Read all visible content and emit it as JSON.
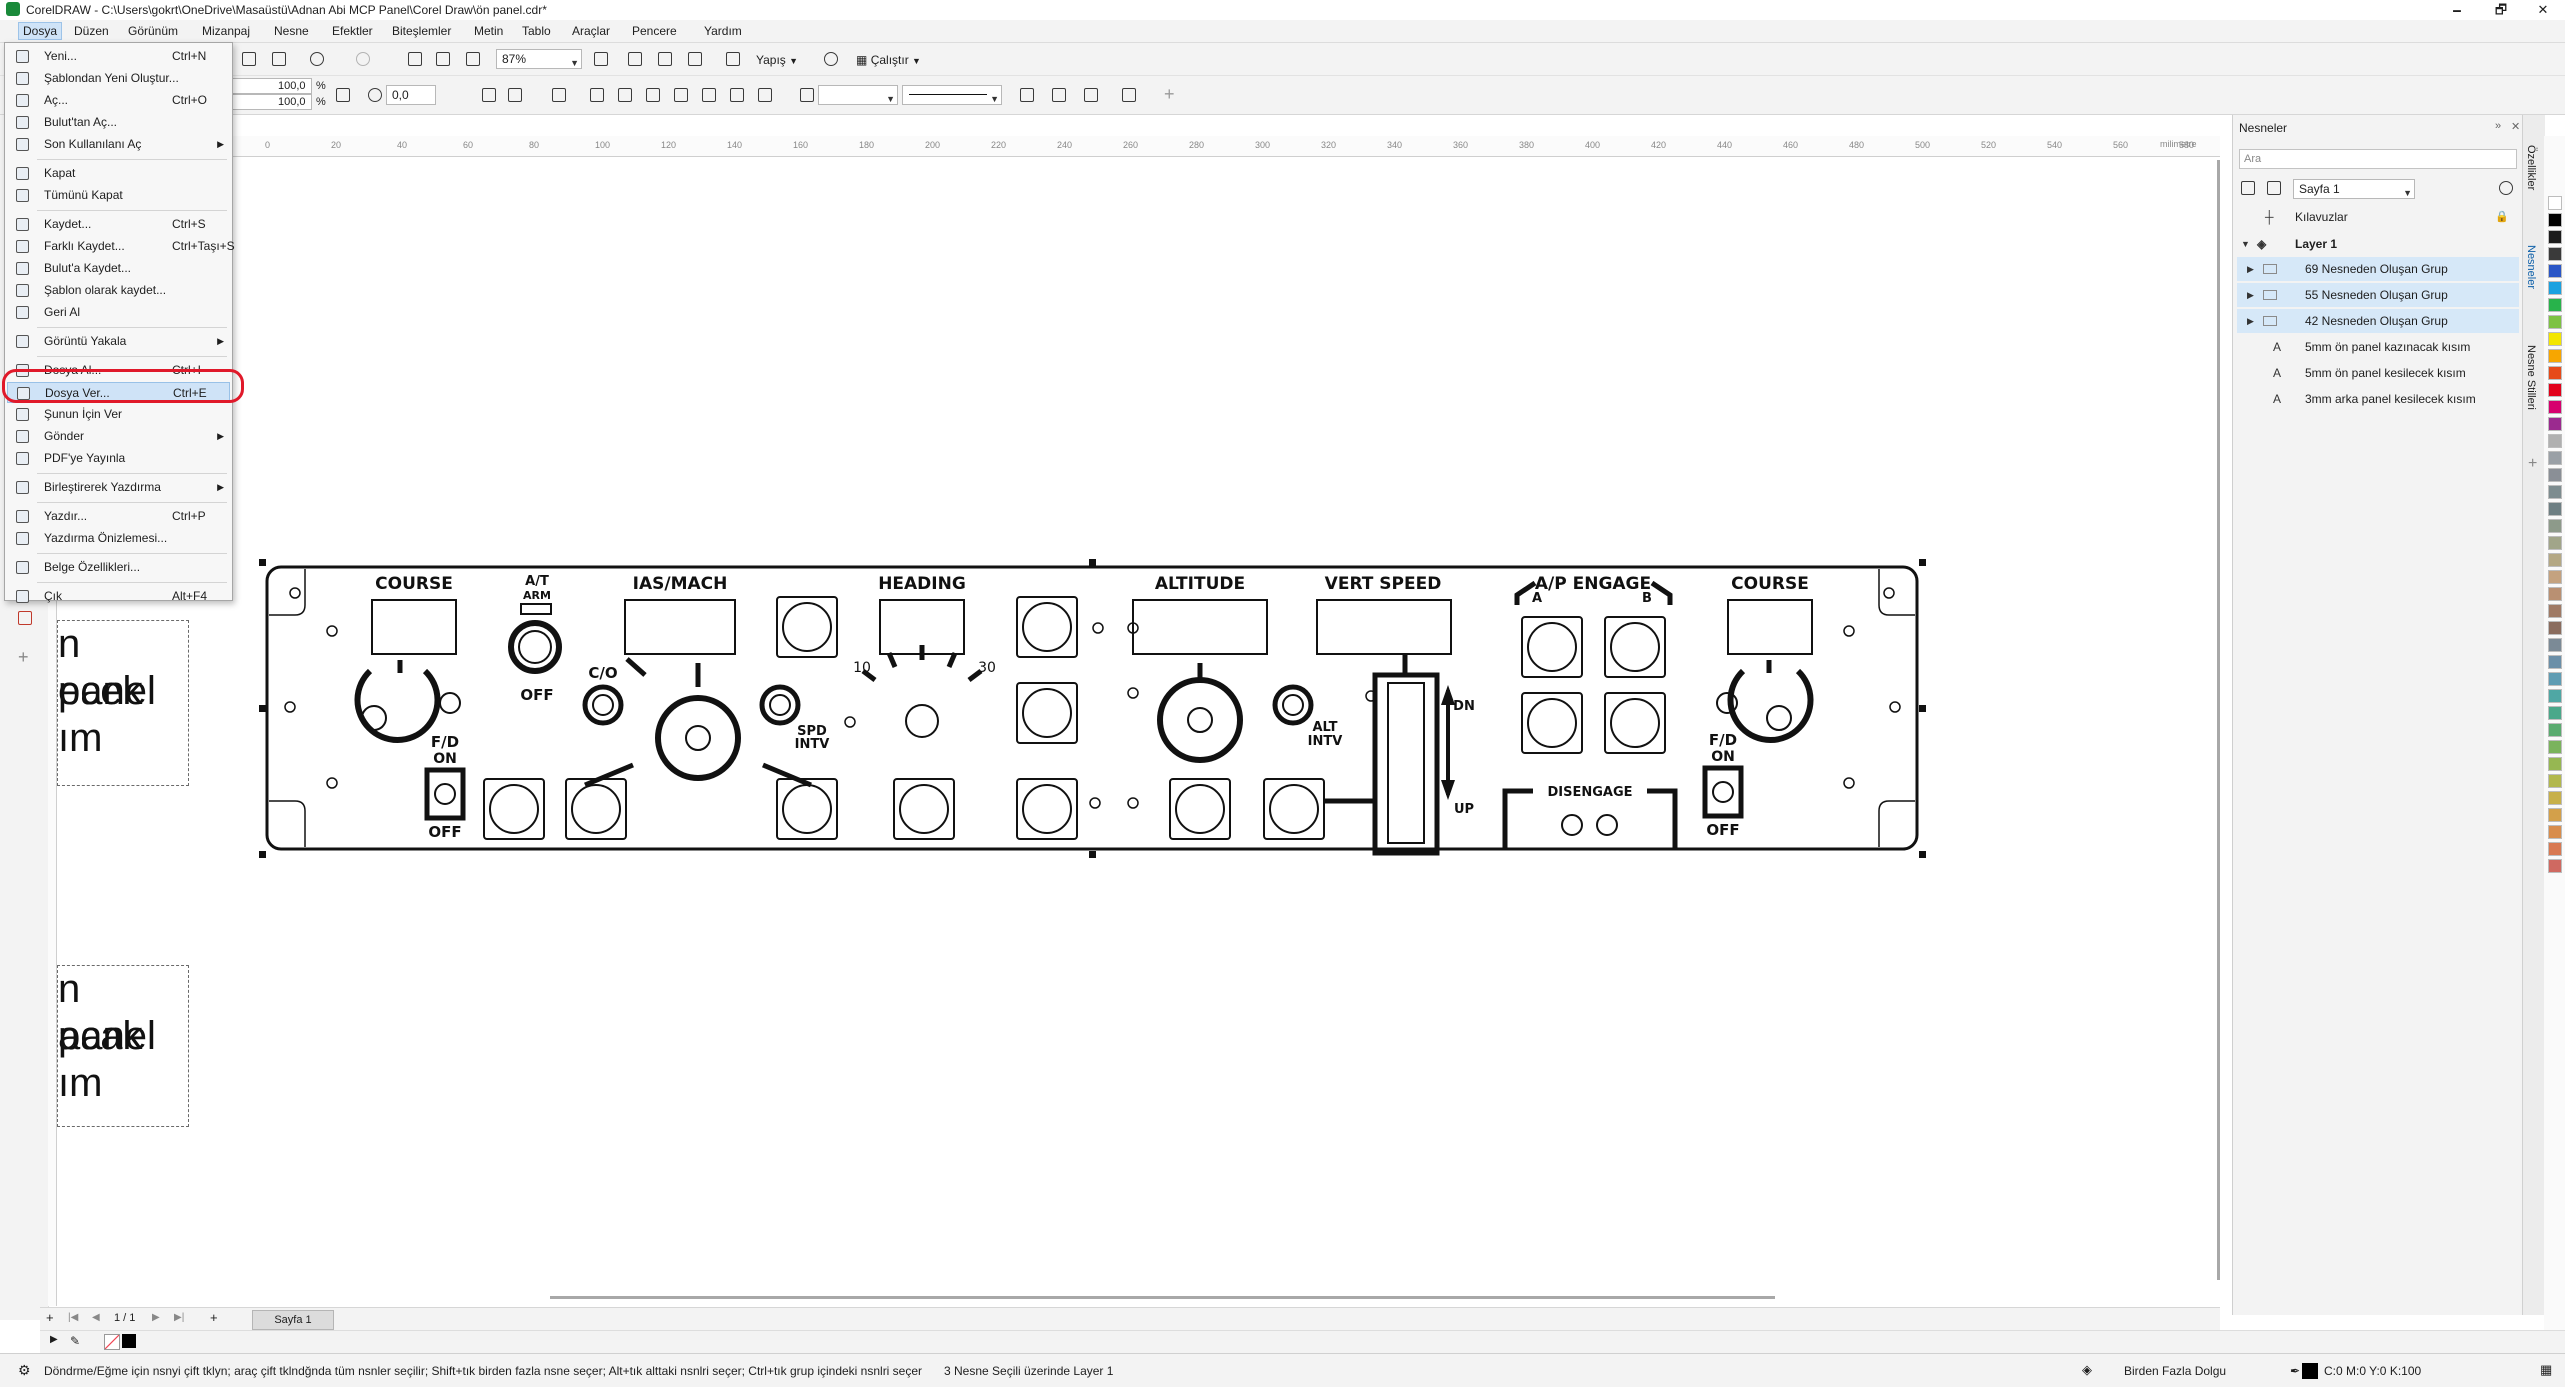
{
  "window": {
    "title": "CorelDRAW - C:\\Users\\gokrt\\OneDrive\\Masaüstü\\Adnan Abi MCP Panel\\Corel Draw\\ön panel.cdr*",
    "minimize": "🗕",
    "restore": "🗗",
    "close": "✕"
  },
  "menu": [
    "Dosya",
    "Düzen",
    "Görünüm",
    "Mizanpaj",
    "Nesne",
    "Efektler",
    "Biteşlemler",
    "Metin",
    "Tablo",
    "Araçlar",
    "Pencere",
    "Yardım"
  ],
  "toolbar": {
    "zoom": "87%",
    "snap_label": "Yapış",
    "launch_label": "Çalıştır",
    "scale_x": "100,0",
    "scale_y": "100,0",
    "percent": "%",
    "rotation": "0,0"
  },
  "file_menu": [
    {
      "label": "Yeni...",
      "shortcut": "Ctrl+N"
    },
    {
      "label": "Şablondan Yeni Oluştur...",
      "shortcut": ""
    },
    {
      "label": "Aç...",
      "shortcut": "Ctrl+O"
    },
    {
      "label": "Bulut'tan Aç...",
      "shortcut": ""
    },
    {
      "label": "Son Kullanılanı Aç",
      "shortcut": "",
      "submenu": true
    },
    {
      "label": "Kapat",
      "shortcut": ""
    },
    {
      "label": "Tümünü Kapat",
      "shortcut": ""
    },
    {
      "label": "Kaydet...",
      "shortcut": "Ctrl+S"
    },
    {
      "label": "Farklı Kaydet...",
      "shortcut": "Ctrl+Taşı+S"
    },
    {
      "label": "Bulut'a Kaydet...",
      "shortcut": ""
    },
    {
      "label": "Şablon olarak kaydet...",
      "shortcut": ""
    },
    {
      "label": "Geri Al",
      "shortcut": ""
    },
    {
      "label": "Görüntü Yakala",
      "shortcut": "",
      "submenu": true
    },
    {
      "label": "Dosya Al...",
      "shortcut": "Ctrl+I"
    },
    {
      "label": "Dosya Ver...",
      "shortcut": "Ctrl+E",
      "highlight": true
    },
    {
      "label": "Şunun İçin Ver",
      "shortcut": ""
    },
    {
      "label": "Gönder",
      "shortcut": "",
      "submenu": true
    },
    {
      "label": "PDF'ye Yayınla",
      "shortcut": ""
    },
    {
      "label": "Birleştirerek Yazdırma",
      "shortcut": "",
      "submenu": true
    },
    {
      "label": "Yazdır...",
      "shortcut": "Ctrl+P"
    },
    {
      "label": "Yazdırma Önizlemesi...",
      "shortcut": ""
    },
    {
      "label": "Belge Özellikleri...",
      "shortcut": ""
    },
    {
      "label": "Çık",
      "shortcut": "Alt+F4"
    }
  ],
  "ruler": {
    "unit": "milimetre",
    "ticks": [
      "0",
      "20",
      "40",
      "60",
      "80",
      "100",
      "120",
      "140",
      "160",
      "180",
      "200",
      "220",
      "240",
      "260",
      "280",
      "300",
      "320",
      "340",
      "360",
      "380",
      "400",
      "420",
      "440",
      "460",
      "480",
      "500",
      "520",
      "540",
      "560",
      "580"
    ]
  },
  "panel": {
    "labels": [
      "COURSE",
      "A/T",
      "ARM",
      "IAS/MACH",
      "HEADING",
      "ALTITUDE",
      "VERT SPEED",
      "A/P ENGAGE",
      "COURSE"
    ],
    "ap_a": "A",
    "ap_b": "B",
    "off1": "OFF",
    "off2": "OFF",
    "off3": "OFF",
    "fd1": "F/D",
    "on1": "ON",
    "fd2": "F/D",
    "on2": "ON",
    "co": "C/O",
    "spd": "SPD",
    "intv1": "INTV",
    "alt": "ALT",
    "intv2": "INTV",
    "h10": "10",
    "h30": "30",
    "dn": "DN",
    "up": "UP",
    "disengage": "DISENGAGE"
  },
  "text_frames": {
    "frame1": [
      "n panel",
      "ecek",
      "ım"
    ],
    "frame2": [
      "n panel",
      "acak",
      "ım"
    ]
  },
  "objects_panel": {
    "title": "Nesneler",
    "search_placeholder": "Ara",
    "page": "Sayfa 1",
    "guides": "Kılavuzlar",
    "layer": "Layer 1",
    "rows": [
      {
        "label": "69 Nesneden Oluşan Grup",
        "selected": true
      },
      {
        "label": "55 Nesneden Oluşan Grup",
        "selected": true
      },
      {
        "label": "42 Nesneden Oluşan Grup",
        "selected": true
      },
      {
        "label": "5mm ön panel kazınacak kısım",
        "selected": false
      },
      {
        "label": "5mm ön panel kesilecek kısım",
        "selected": false
      },
      {
        "label": "3mm arka panel kesilecek kısım",
        "selected": false
      }
    ]
  },
  "side_tabs": [
    "Özellikler",
    "Nesneler",
    "Nesne Stilleri"
  ],
  "palette": [
    "#ffffff",
    "#000000",
    "#1b1b1b",
    "#3a3a3a",
    "#2a56c6",
    "#1aa1e0",
    "#28b34b",
    "#7dc242",
    "#f3e600",
    "#f7a600",
    "#e64a19",
    "#e2001a",
    "#d6006e",
    "#9b2a8f",
    "#b0b0b0",
    "#9aa0a6",
    "#8a8f96",
    "#7d8c8f",
    "#6e7f83",
    "#8d9a8a",
    "#a1a589",
    "#b4a884",
    "#c4a27f",
    "#b99072",
    "#9f7a65",
    "#8a6c5e",
    "#7b8a96",
    "#6b8fa8",
    "#5f9cb3",
    "#4fa7a4",
    "#4aa88a",
    "#5aab6f",
    "#7ab35c",
    "#96b752",
    "#b2b84d",
    "#c7b04a",
    "#d3a04a",
    "#d88d4c",
    "#d87952",
    "#cf6961"
  ],
  "page_bar": {
    "counter": "1 / 1",
    "page_tab": "Sayfa 1"
  },
  "status": {
    "hint": "Döndrme/Eğme için nsnyi çift tklyn; araç çift tklndğnda tüm nsnler seçilir; Shift+tık birden fazla nsne seçer; Alt+tık alttaki nsnlri seçer; Ctrl+tık grup içindeki nsnlri seçer",
    "selection": "3 Nesne Seçili üzerinde Layer 1",
    "fill": "Birden Fazla Dolgu",
    "color": "C:0 M:0 Y:0 K:100"
  }
}
